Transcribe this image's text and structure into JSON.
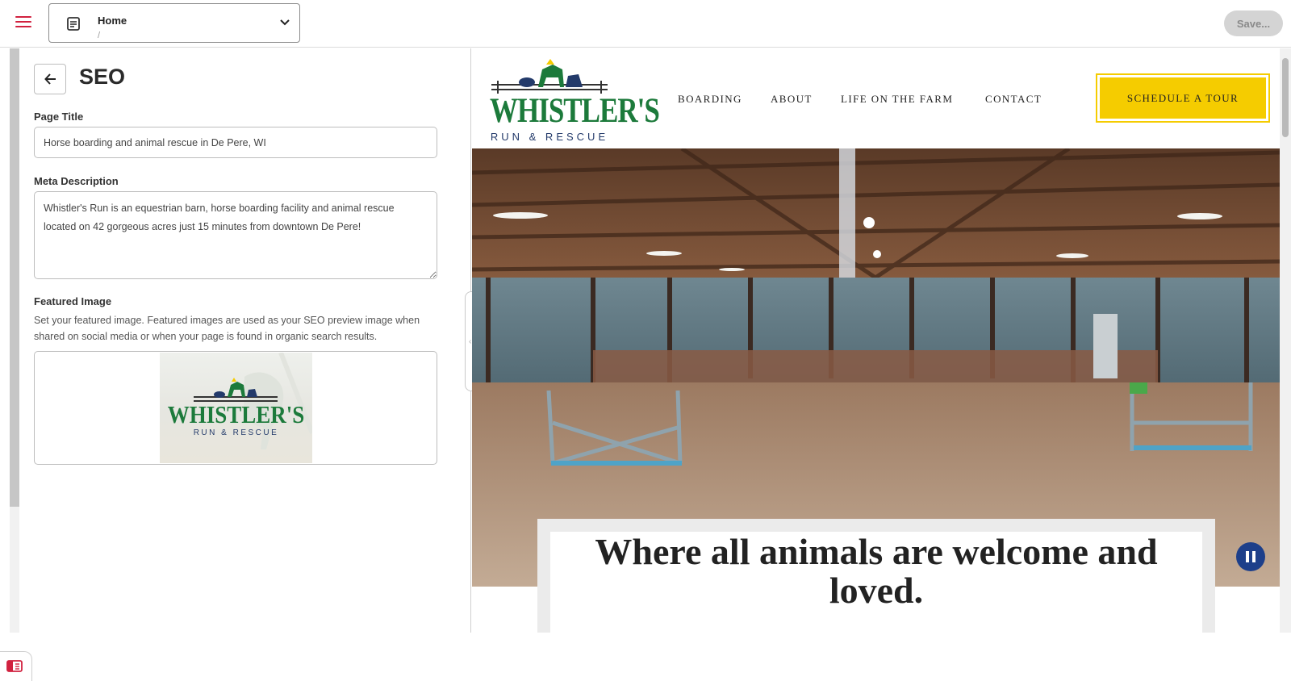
{
  "topbar": {
    "page_title": "Home",
    "page_path": "/",
    "save_label": "Save..."
  },
  "seo": {
    "heading": "SEO",
    "page_title_label": "Page Title",
    "page_title_value": "Horse boarding and animal rescue in De Pere, WI",
    "meta_description_label": "Meta Description",
    "meta_description_value": "Whistler's Run is an equestrian barn, horse boarding facility and animal rescue located on 42 gorgeous acres just 15 minutes from downtown De Pere!",
    "featured_image_label": "Featured Image",
    "featured_image_help": "Set your featured image. Featured images are used as your SEO preview image when shared on social media or when your page is found in organic search results."
  },
  "site": {
    "logo_word": "WHISTLER'S",
    "logo_sub": "RUN & RESCUE",
    "nav": [
      "BOARDING",
      "ABOUT",
      "LIFE ON THE FARM",
      "CONTACT"
    ],
    "cta": "SCHEDULE A TOUR",
    "hero_title": "Where all animals are welcome and loved."
  },
  "colors": {
    "accent_red": "#d1213f",
    "logo_green": "#1c7a3b",
    "logo_navy": "#233a6a",
    "cta_yellow": "#f5cc00",
    "pause_blue": "#1d3f8a"
  },
  "icons": {
    "menu": "hamburger-icon",
    "page": "document-icon",
    "dropdown": "chevron-down-icon",
    "back": "arrow-left-icon",
    "pause": "pause-icon",
    "panel": "sidebar-toggle-icon"
  }
}
